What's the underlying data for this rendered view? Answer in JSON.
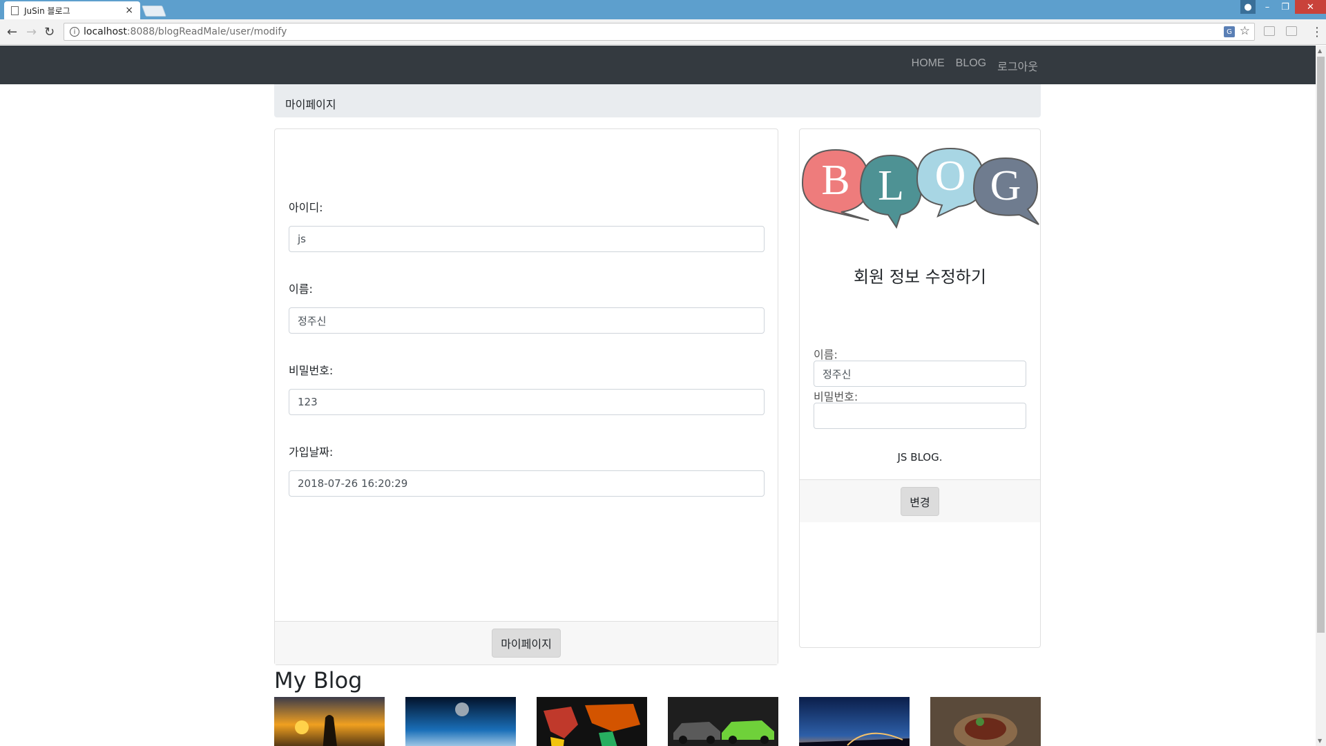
{
  "browser": {
    "tab_title": "JuSin 블로그",
    "tab_close": "×",
    "url_host": "localhost",
    "url_rest": ":8088/blogReadMale/user/modify"
  },
  "navbar": {
    "links": [
      "HOME",
      "BLOG",
      "로그아웃"
    ]
  },
  "breadcrumb": "마이페이지",
  "profile": {
    "id_label": "아이디:",
    "id_value": "js",
    "name_label": "이름:",
    "name_value": "정주신",
    "password_label": "비밀번호:",
    "password_value": "123",
    "joined_label": "가입날짜:",
    "joined_value": "2018-07-26 16:20:29",
    "mypage_button": "마이페이지"
  },
  "edit_card": {
    "logo_letters": [
      "B",
      "L",
      "O",
      "G"
    ],
    "title": "회원 정보 수정하기",
    "name_label": "이름:",
    "name_value": "정주신",
    "password_label": "비밀번호:",
    "password_value": "",
    "footer_text": "JS BLOG.",
    "change_button": "변경"
  },
  "section_title": "My Blog",
  "thumbnails": [
    "sunset-couple",
    "moon-earth",
    "world-map-words",
    "cars",
    "night-bridge",
    "food-plate"
  ],
  "colors": {
    "navbar": "#343a40",
    "tabbar": "#5d9fcd",
    "bubble_b": "#ee7c7c",
    "bubble_l": "#4e9294",
    "bubble_o": "#a8d6e4",
    "bubble_g": "#6f7c8f"
  }
}
